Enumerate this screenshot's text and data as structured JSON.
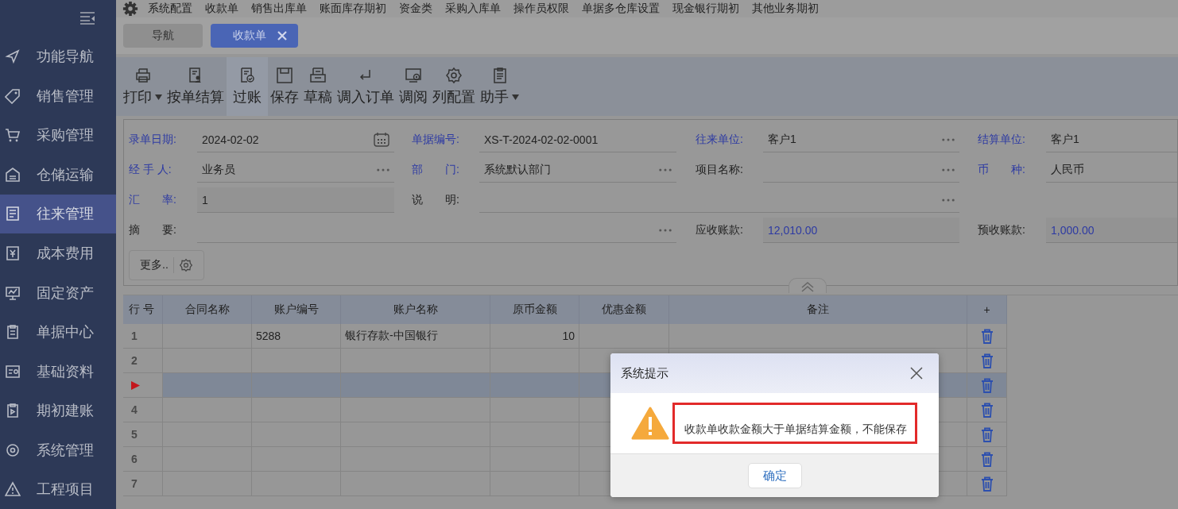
{
  "sidebar": {
    "items": [
      {
        "label": "功能导航",
        "selected": false
      },
      {
        "label": "销售管理",
        "selected": false
      },
      {
        "label": "采购管理",
        "selected": false
      },
      {
        "label": "仓储运输",
        "selected": false
      },
      {
        "label": "往来管理",
        "selected": true
      },
      {
        "label": "成本费用",
        "selected": false
      },
      {
        "label": "固定资产",
        "selected": false
      },
      {
        "label": "单据中心",
        "selected": false
      },
      {
        "label": "基础资料",
        "selected": false
      },
      {
        "label": "期初建账",
        "selected": false
      },
      {
        "label": "系统管理",
        "selected": false
      },
      {
        "label": "工程项目",
        "selected": false
      }
    ]
  },
  "menu_bar": {
    "items": [
      "系统配置",
      "收款单",
      "销售出库单",
      "账面库存期初",
      "资金类",
      "采购入库单",
      "操作员权限",
      "单据多仓库设置",
      "现金银行期初",
      "其他业务期初"
    ]
  },
  "tabs": [
    {
      "label": "导航",
      "selected": false,
      "closable": false
    },
    {
      "label": "收款单",
      "selected": true,
      "closable": true
    }
  ],
  "toolbar": [
    {
      "label": "打印",
      "dropdown": true,
      "highlighted": false
    },
    {
      "label": "按单结算",
      "dropdown": false,
      "highlighted": false
    },
    {
      "label": "过账",
      "dropdown": false,
      "highlighted": true
    },
    {
      "label": "保存",
      "dropdown": false,
      "highlighted": false
    },
    {
      "label": "草稿",
      "dropdown": false,
      "highlighted": false
    },
    {
      "label": "调入订单",
      "dropdown": false,
      "highlighted": false
    },
    {
      "label": "调阅",
      "dropdown": false,
      "highlighted": false
    },
    {
      "label": "列配置",
      "dropdown": false,
      "highlighted": false
    },
    {
      "label": "助手",
      "dropdown": true,
      "highlighted": false
    }
  ],
  "form": {
    "fields": [
      {
        "label": "录单日期:",
        "value": "2024-02-02",
        "required": true,
        "kind": "date"
      },
      {
        "label": "单据编号:",
        "value": "XS-T-2024-02-02-0001",
        "required": true,
        "kind": "plain"
      },
      {
        "label": "往来单位:",
        "value": "客户1",
        "required": true,
        "kind": "lookup"
      },
      {
        "label": "结算单位:",
        "value": "客户1",
        "required": true,
        "kind": "plain"
      },
      {
        "label": "经 手 人:",
        "value": "业务员",
        "required": true,
        "kind": "lookup"
      },
      {
        "label": "部　　门:",
        "value": "系统默认部门",
        "required": true,
        "kind": "lookup"
      },
      {
        "label": "项目名称:",
        "required": false,
        "kind": "lookup"
      },
      {
        "label": "币　　种:",
        "value": "人民币",
        "required": true,
        "kind": "plain"
      },
      {
        "label": "汇　　率:",
        "value": "1",
        "required": true,
        "kind": "rate"
      },
      {
        "label": "说　　明:",
        "required": false,
        "kind": "memo"
      },
      {
        "label": "摘　　要:",
        "required": false,
        "kind": "memo"
      },
      {
        "label": "应收账款:",
        "value": "12,010.00",
        "required": false,
        "kind": "amount"
      },
      {
        "label": "预收账款:",
        "value": "1,000.00",
        "required": false,
        "kind": "amount"
      }
    ],
    "more_button": "更多.."
  },
  "table": {
    "columns": [
      "行 号",
      "合同名称",
      "账户编号",
      "账户名称",
      "原币金额",
      "优惠金额",
      "备注",
      "+"
    ],
    "rows": [
      {
        "no": "1",
        "account_no": "5288",
        "account_name": "银行存款-中国银行",
        "amount": "10",
        "selected": false
      },
      {
        "no": "2",
        "selected": false
      },
      {
        "selected": true
      },
      {
        "no": "4",
        "selected": false
      },
      {
        "no": "5",
        "selected": false
      },
      {
        "no": "6",
        "selected": false
      },
      {
        "no": "7",
        "selected": false
      }
    ]
  },
  "dialog": {
    "title": "系统提示",
    "message": "收款单收款金额大于单据结算金额，不能保存",
    "button": "确定"
  }
}
